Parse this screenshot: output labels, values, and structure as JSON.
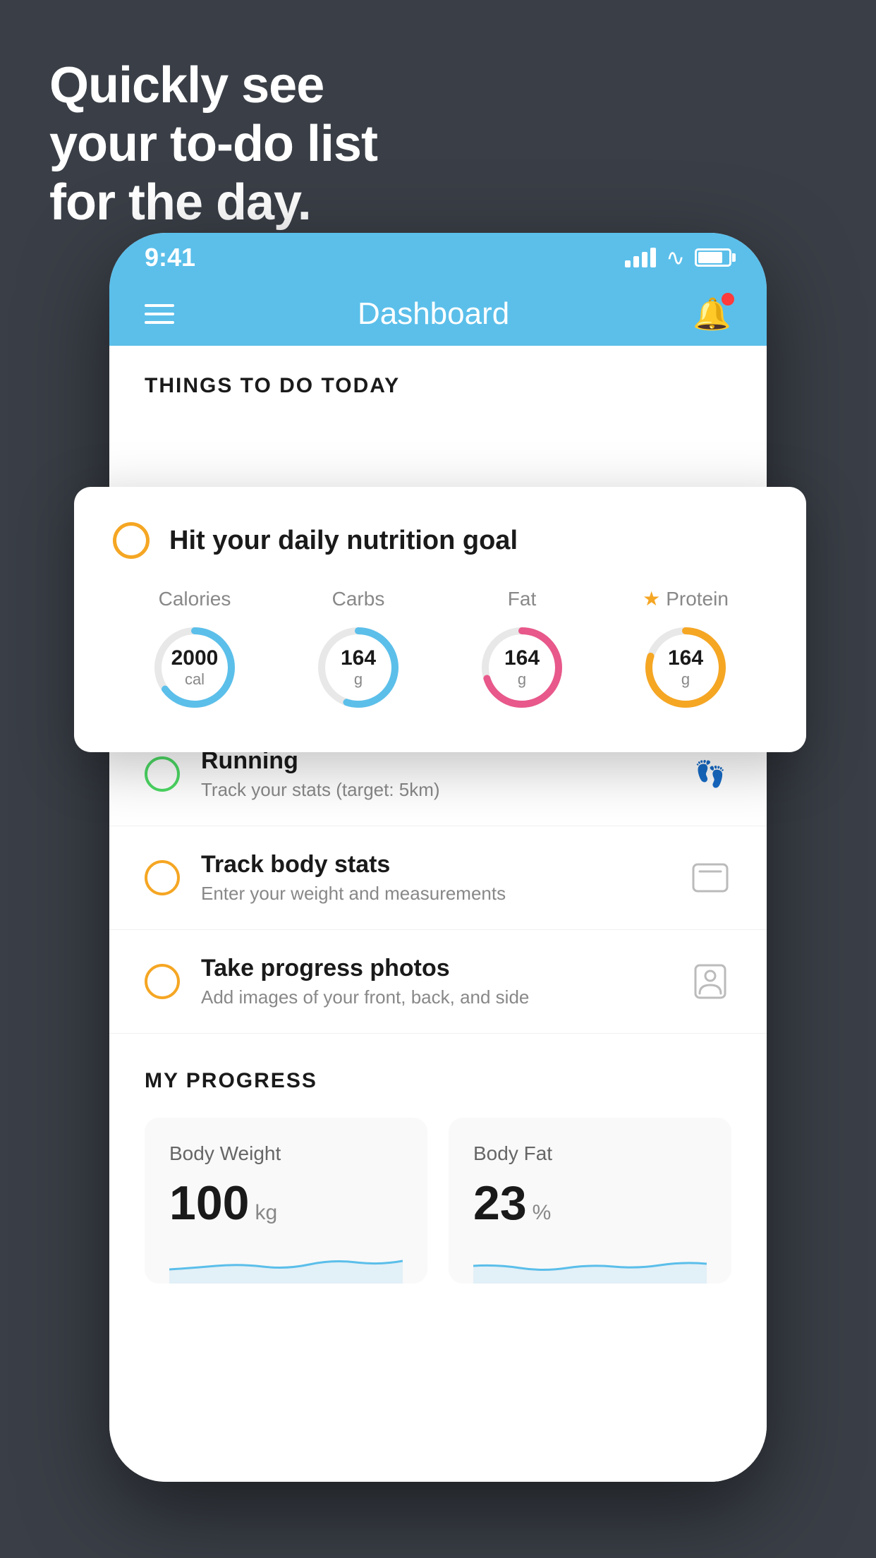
{
  "background_color": "#3a3f47",
  "hero": {
    "line1": "Quickly see",
    "line2": "your to-do list",
    "line3": "for the day."
  },
  "status_bar": {
    "time": "9:41",
    "battery_level": 80
  },
  "header": {
    "title": "Dashboard"
  },
  "things_section": {
    "title": "THINGS TO DO TODAY"
  },
  "nutrition_card": {
    "indicator_color": "#f5a623",
    "title": "Hit your daily nutrition goal",
    "stats": [
      {
        "label": "Calories",
        "value": "2000",
        "unit": "cal",
        "color": "#5bbfea",
        "percentage": 65
      },
      {
        "label": "Carbs",
        "value": "164",
        "unit": "g",
        "color": "#5bbfea",
        "percentage": 55
      },
      {
        "label": "Fat",
        "value": "164",
        "unit": "g",
        "color": "#e8588a",
        "percentage": 70
      },
      {
        "label": "Protein",
        "value": "164",
        "unit": "g",
        "color": "#f5a623",
        "percentage": 80,
        "starred": true
      }
    ]
  },
  "todo_items": [
    {
      "id": "running",
      "title": "Running",
      "subtitle": "Track your stats (target: 5km)",
      "circle_color": "green",
      "icon_type": "shoe"
    },
    {
      "id": "body-stats",
      "title": "Track body stats",
      "subtitle": "Enter your weight and measurements",
      "circle_color": "yellow",
      "icon_type": "scale"
    },
    {
      "id": "progress-photos",
      "title": "Take progress photos",
      "subtitle": "Add images of your front, back, and side",
      "circle_color": "yellow2",
      "icon_type": "person"
    }
  ],
  "my_progress": {
    "title": "MY PROGRESS",
    "cards": [
      {
        "id": "body-weight",
        "title": "Body Weight",
        "value": "100",
        "unit": "kg"
      },
      {
        "id": "body-fat",
        "title": "Body Fat",
        "value": "23",
        "unit": "%"
      }
    ]
  }
}
